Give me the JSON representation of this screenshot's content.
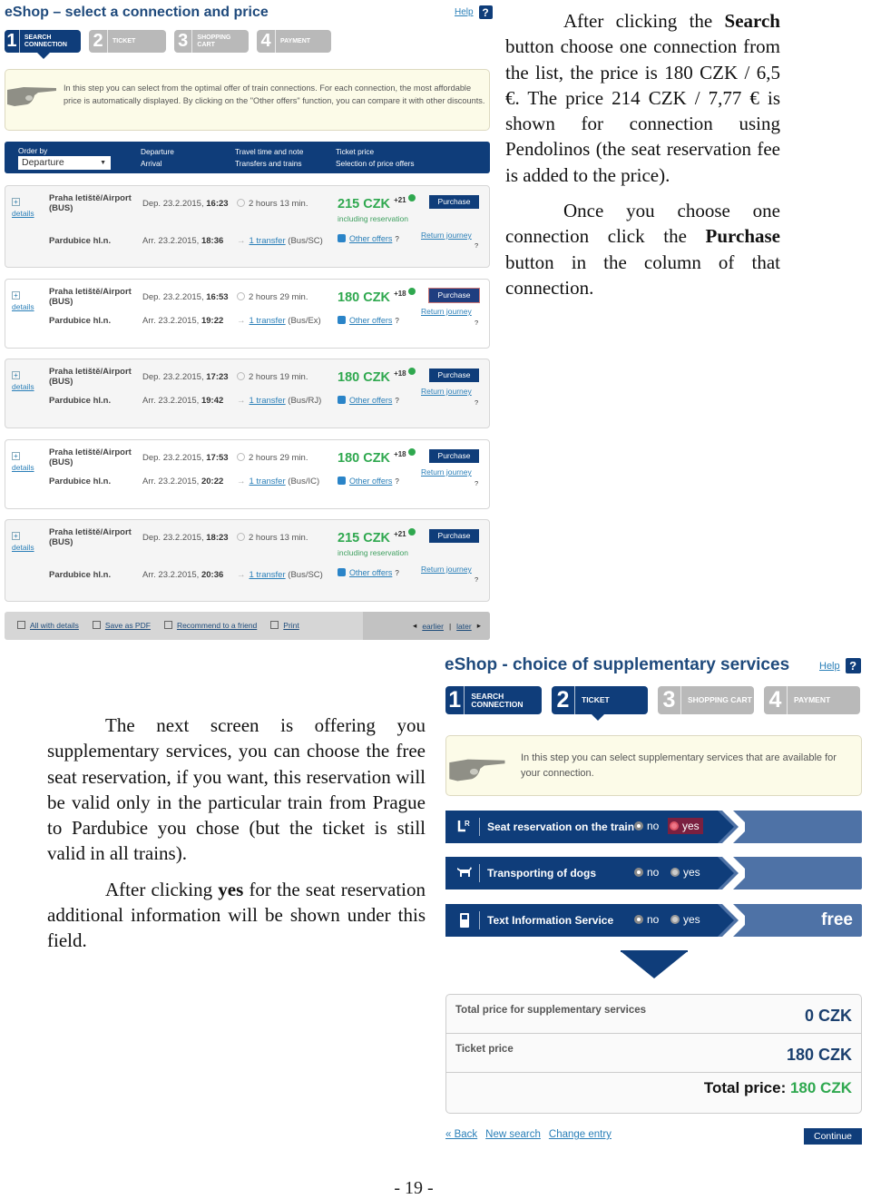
{
  "document": {
    "right_text": {
      "p1": [
        "After clicking the ",
        "Search",
        " button choose one connection from the list, the price is 180 CZK / 6,5 €. The price 214 CZK / 7,77 € is shown for connection using Pendolinos (the seat reservation fee is added to the price)."
      ],
      "p2": [
        "Once you choose one connection click the ",
        "Purchase",
        " button in the column of that connection."
      ]
    },
    "left_text": {
      "p1": "The next screen is offering you supplementary services, you can choose the free seat reservation, if you want, this reservation will be valid only in the particular train from Prague to Pardubice you chose (but the ticket is still valid in all trains).",
      "p2": [
        "After clicking ",
        "yes",
        " for the seat reservation additional information will be shown under this field."
      ]
    },
    "page_number": "- 19 -"
  },
  "screen1": {
    "title": "eShop – select a connection and price",
    "help": "Help",
    "help_icon": "?",
    "steps": [
      {
        "num": "1",
        "label": "Search connection",
        "state": "active"
      },
      {
        "num": "2",
        "label": "Ticket",
        "state": "inactive"
      },
      {
        "num": "3",
        "label": "Shopping cart",
        "state": "inactive"
      },
      {
        "num": "4",
        "label": "Payment",
        "state": "inactive"
      }
    ],
    "info": "In this step you can select from the optimal offer of train connections. For each connection, the most affordable price is automatically displayed. By clicking on the \"Other offers\" function, you can compare it with other discounts.",
    "header": {
      "order_by_label": "Order by",
      "order_by_value": "Departure",
      "col_departure": "Departure",
      "col_arrival": "Arrival",
      "col_travel_time": "Travel time and note",
      "col_transfers": "Transfers and trains",
      "col_ticket_price": "Ticket price",
      "col_price_offers": "Selection of price offers"
    },
    "connections": [
      {
        "details": "details",
        "from": "Praha letiště/Airport (BUS)",
        "to": "Pardubice hl.n.",
        "dep_prefix": "Dep. 23.2.2015, ",
        "dep_time": "16:23",
        "arr_prefix": "Arr. 23.2.2015, ",
        "arr_time": "18:36",
        "duration": "2 hours 13 min.",
        "transfer": "1 transfer",
        "trains": "(Bus/SC)",
        "price": "215 CZK",
        "bonus": "+21",
        "note": "including reservation",
        "other_offers": "Other offers",
        "purchase": "Purchase",
        "return": "Return journey"
      },
      {
        "details": "details",
        "from": "Praha letiště/Airport (BUS)",
        "to": "Pardubice hl.n.",
        "dep_prefix": "Dep. 23.2.2015, ",
        "dep_time": "16:53",
        "arr_prefix": "Arr. 23.2.2015, ",
        "arr_time": "19:22",
        "duration": "2 hours 29 min.",
        "transfer": "1 transfer",
        "trains": "(Bus/Ex)",
        "price": "180 CZK",
        "bonus": "+18",
        "note": "",
        "other_offers": "Other offers",
        "purchase": "Purchase",
        "return": "Return journey"
      },
      {
        "details": "details",
        "from": "Praha letiště/Airport (BUS)",
        "to": "Pardubice hl.n.",
        "dep_prefix": "Dep. 23.2.2015, ",
        "dep_time": "17:23",
        "arr_prefix": "Arr. 23.2.2015, ",
        "arr_time": "19:42",
        "duration": "2 hours 19 min.",
        "transfer": "1 transfer",
        "trains": "(Bus/RJ)",
        "price": "180 CZK",
        "bonus": "+18",
        "note": "",
        "other_offers": "Other offers",
        "purchase": "Purchase",
        "return": "Return journey"
      },
      {
        "details": "details",
        "from": "Praha letiště/Airport (BUS)",
        "to": "Pardubice hl.n.",
        "dep_prefix": "Dep. 23.2.2015, ",
        "dep_time": "17:53",
        "arr_prefix": "Arr. 23.2.2015, ",
        "arr_time": "20:22",
        "duration": "2 hours 29 min.",
        "transfer": "1 transfer",
        "trains": "(Bus/IC)",
        "price": "180 CZK",
        "bonus": "+18",
        "note": "",
        "other_offers": "Other offers",
        "purchase": "Purchase",
        "return": "Return journey"
      },
      {
        "details": "details",
        "from": "Praha letiště/Airport (BUS)",
        "to": "Pardubice hl.n.",
        "dep_prefix": "Dep. 23.2.2015, ",
        "dep_time": "18:23",
        "arr_prefix": "Arr. 23.2.2015, ",
        "arr_time": "20:36",
        "duration": "2 hours 13 min.",
        "transfer": "1 transfer",
        "trains": "(Bus/SC)",
        "price": "215 CZK",
        "bonus": "+21",
        "note": "including reservation",
        "other_offers": "Other offers",
        "purchase": "Purchase",
        "return": "Return journey"
      }
    ],
    "question_mark": "?",
    "plus": "+",
    "footer": {
      "all_details": "All with details",
      "save_pdf": "Save as PDF",
      "recommend": "Recommend to a friend",
      "print": "Print",
      "earlier": "earlier",
      "later": "later"
    }
  },
  "screen2": {
    "title": "eShop - choice of supplementary services",
    "help": "Help",
    "help_icon": "?",
    "steps": [
      {
        "num": "1",
        "label": "Search connection",
        "state": "active"
      },
      {
        "num": "2",
        "label": "Ticket",
        "state": "active-current"
      },
      {
        "num": "3",
        "label": "Shopping cart",
        "state": "inactive"
      },
      {
        "num": "4",
        "label": "Payment",
        "state": "inactive"
      }
    ],
    "info": "In this step you can select supplementary services that are available for your connection.",
    "services": [
      {
        "icon": "seat-reservation-icon",
        "name": "Seat reservation on the train",
        "no": "no",
        "yes": "yes",
        "selected": "no",
        "highlight": "yes",
        "price": ""
      },
      {
        "icon": "dog-icon",
        "name": "Transporting of dogs",
        "no": "no",
        "yes": "yes",
        "selected": "no",
        "price": ""
      },
      {
        "icon": "mobile-phone-icon",
        "name": "Text Information Service",
        "no": "no",
        "yes": "yes",
        "selected": "no",
        "price": "free"
      }
    ],
    "totals": {
      "supplementary_label": "Total price for supplementary services",
      "supplementary_value": "0 CZK",
      "ticket_label": "Ticket price",
      "ticket_value": "180 CZK",
      "total_label": "Total price: ",
      "total_value": "180 CZK"
    },
    "nav": {
      "back": "« Back",
      "new_search": "New search",
      "change_entry": "Change entry",
      "continue": "Continue"
    }
  },
  "colors": {
    "brand_blue": "#0f3d7a",
    "price_green": "#2fa84f",
    "link_blue": "#2a7fb8",
    "inactive_step": "#b9b9b9",
    "info_bg": "#fcfbe8"
  }
}
